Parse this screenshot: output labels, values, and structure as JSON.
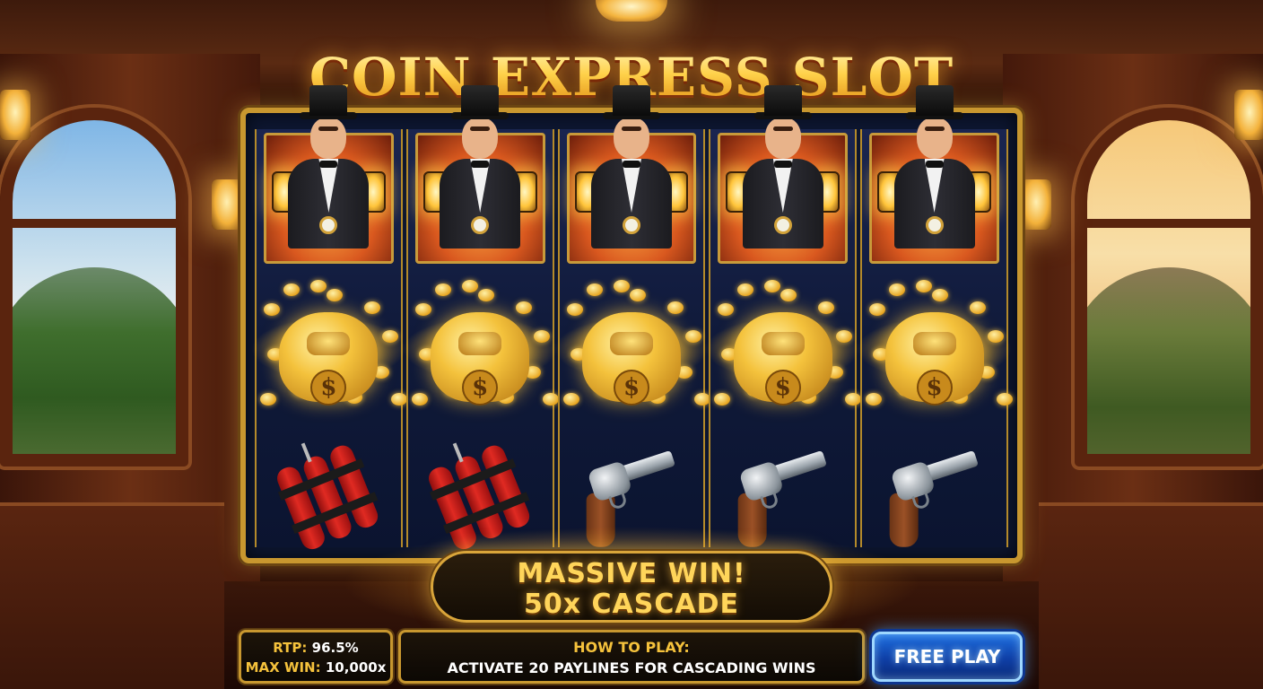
{
  "game": {
    "title": "COIN EXPRESS SLOT"
  },
  "reels": [
    [
      "conductor",
      "money-bag",
      "dynamite"
    ],
    [
      "conductor",
      "money-bag",
      "dynamite"
    ],
    [
      "conductor",
      "money-bag",
      "revolver"
    ],
    [
      "conductor",
      "money-bag",
      "revolver"
    ],
    [
      "conductor",
      "money-bag",
      "revolver"
    ]
  ],
  "win_banner": {
    "line1": "MASSIVE WIN!",
    "line2": "50x CASCADE"
  },
  "stats": {
    "rtp_label": "RTP:",
    "rtp_value": "96.5%",
    "max_win_label": "MAX WIN:",
    "max_win_value": "10,000x"
  },
  "how_to_play": {
    "title": "HOW TO PLAY:",
    "text": "ACTIVATE 20 PAYLINES FOR CASCADING WINS"
  },
  "actions": {
    "free_play_label": "FREE PLAY"
  },
  "colors": {
    "gold": "#ffd55a",
    "accent_blue": "#1e6fe0",
    "reel_bg": "#101a3a"
  }
}
